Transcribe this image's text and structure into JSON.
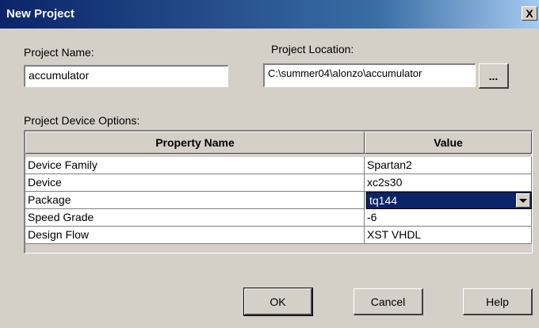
{
  "window": {
    "title": "New Project",
    "close_symbol": "X"
  },
  "project_name": {
    "label": "Project Name:",
    "value": "accumulator"
  },
  "project_location": {
    "label": "Project Location:",
    "value": "C:\\summer04\\alonzo\\accumulator",
    "browse_label": "..."
  },
  "device_options": {
    "label": "Project Device Options:",
    "columns": [
      "Property Name",
      "Value"
    ],
    "rows": [
      {
        "name": "Device Family",
        "value": "Spartan2"
      },
      {
        "name": "Device",
        "value": "xc2s30"
      },
      {
        "name": "Package",
        "value": "tq144"
      },
      {
        "name": "Speed Grade",
        "value": "-6"
      },
      {
        "name": "Design Flow",
        "value": "XST VHDL"
      }
    ]
  },
  "buttons": {
    "ok": "OK",
    "cancel": "Cancel",
    "help": "Help"
  },
  "colors": {
    "titlebar": "#0a246a",
    "dialog_bg": "#d4d0c8",
    "selection": "#0a246a"
  }
}
